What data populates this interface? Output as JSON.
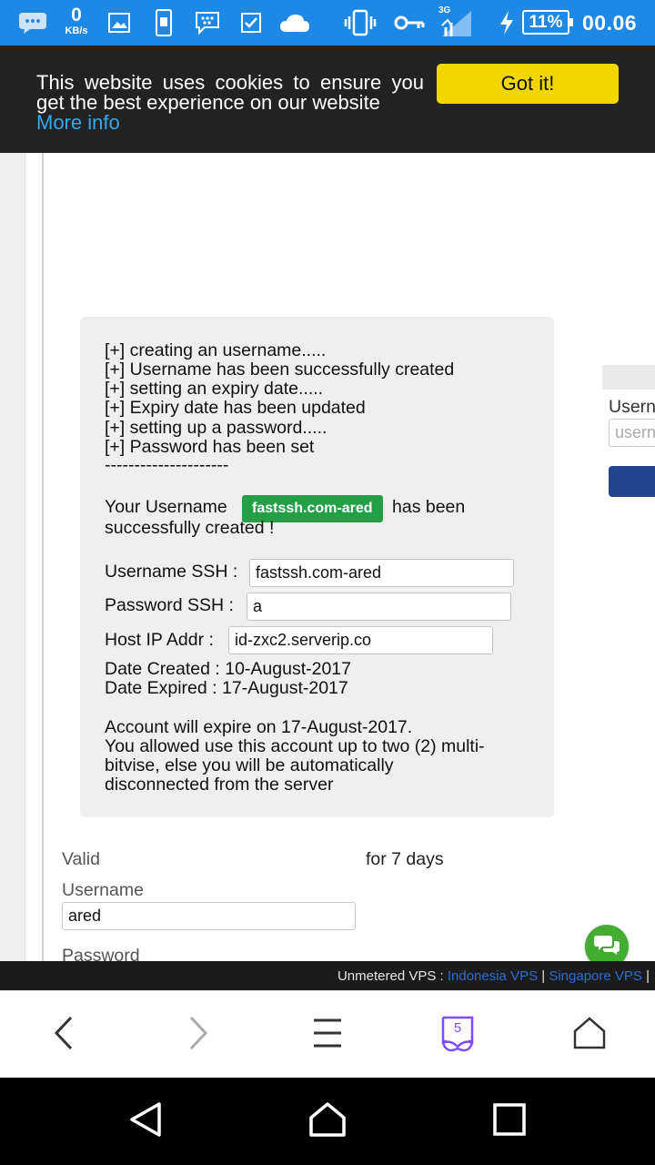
{
  "status_bar": {
    "data_rate_value": "0",
    "data_rate_unit": "KB/s",
    "network_label": "3G",
    "battery": "11%",
    "time": "00.06",
    "icons": [
      "bbm-chat-icon",
      "image-icon",
      "device-icon",
      "blackberry-icon",
      "checkbox-icon",
      "cloud-icon",
      "vibrate-icon",
      "key-icon",
      "signal-icon",
      "charging-icon"
    ]
  },
  "cookie_banner": {
    "message": "This website uses cookies to ensure you get the best experience on our website",
    "more_info": "More info",
    "accept_label": "Got it!"
  },
  "result": {
    "log_lines": [
      "[+] creating an username.....",
      "[+] Username has been successfully created",
      "[+] setting an expiry date.....",
      "[+] Expiry date has been updated",
      "[+] setting up a password.....",
      "[+] Password has been set",
      "---------------------"
    ],
    "your_username_prefix": "Your Username",
    "username_badge": "fastssh.com-ared",
    "your_username_suffix": "has been",
    "created_line": "successfully created !",
    "ssh_username_label": "Username SSH :",
    "ssh_username_value": "fastssh.com-ared",
    "ssh_password_label": "Password SSH :",
    "ssh_password_value": "a",
    "host_label": "Host IP Addr :",
    "host_value": "id-zxc2.serverip.co",
    "date_created": "Date Created : 10-August-2017",
    "date_expired": "Date Expired : 17-August-2017",
    "expire_note": "Account will expire on 17-August-2017.",
    "usage_line_1": "You allowed use this account up to two (2) multi-",
    "usage_line_2": "bitvise, else you will be automatically",
    "usage_line_3": "disconnected from the server"
  },
  "form": {
    "valid_label": "Valid",
    "valid_value": "for 7 days",
    "username_label": "Username",
    "username_value": "ared",
    "password_label": "Password"
  },
  "side_panel": {
    "username_label": "Usern",
    "username_placeholder": "usern",
    "button_color": "#22468e"
  },
  "footer": {
    "prefix": "Unmetered VPS :",
    "link_1": "Indonesia VPS",
    "separator": "|",
    "link_2": "Singapore VPS"
  },
  "browser_toolbar": {
    "tab_count": "5",
    "buttons": [
      "back-icon",
      "forward-icon",
      "menu-icon",
      "tabs-icon",
      "home-icon"
    ]
  },
  "colors": {
    "status_bar": "#1e88e5",
    "cookie_button": "#f1d600",
    "link": "#31a8f0",
    "badge": "#23a046",
    "chat": "#43ad32",
    "tabs_accent": "#7c4dff"
  }
}
